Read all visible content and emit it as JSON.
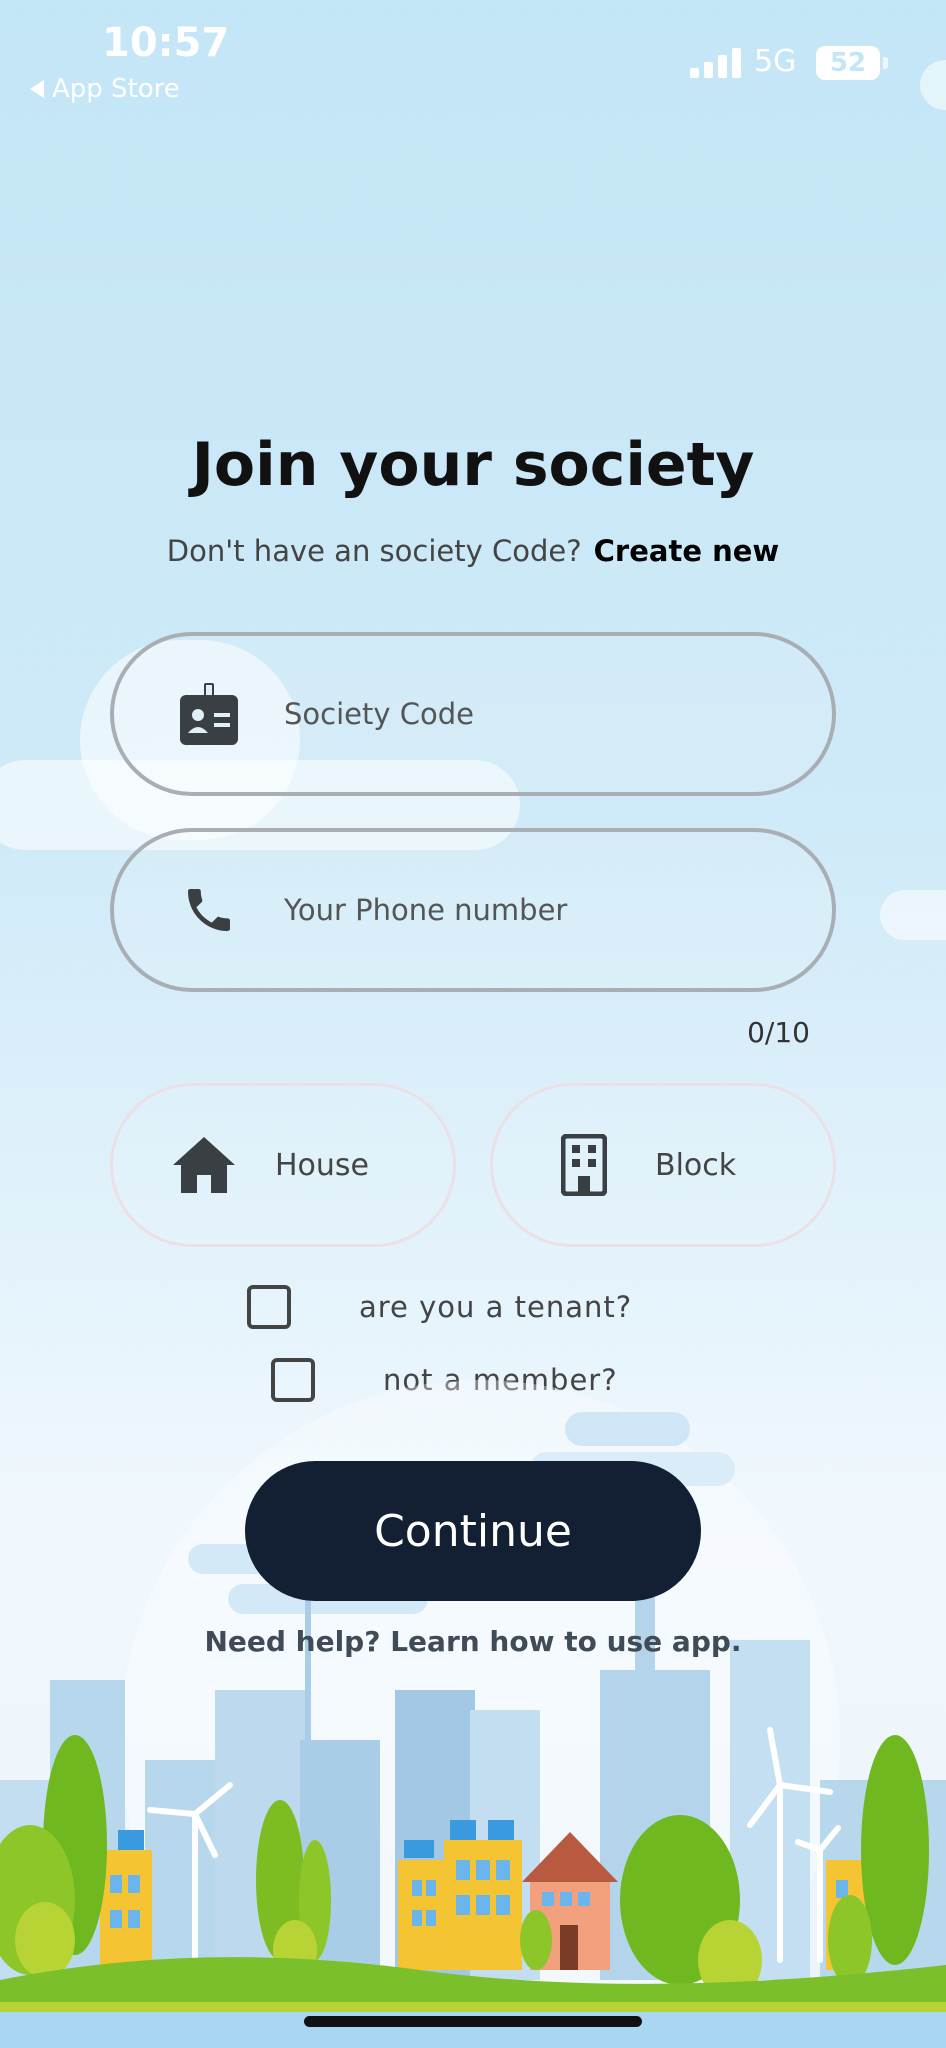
{
  "status_bar": {
    "time": "10:57",
    "back_label": "App Store",
    "network": "5G",
    "battery": "52"
  },
  "header": {
    "title": "Join your society",
    "subtitle": "Don't have an society Code?",
    "create_link": "Create new"
  },
  "form": {
    "society_code": {
      "placeholder": "Society Code",
      "icon": "id-badge-icon"
    },
    "phone": {
      "placeholder": "Your Phone number",
      "icon": "phone-icon",
      "counter": "0/10"
    },
    "house": {
      "label": "House",
      "icon": "house-icon"
    },
    "block": {
      "label": "Block",
      "icon": "building-icon"
    },
    "tenant_checkbox": {
      "label": "are you a tenant?",
      "checked": false
    },
    "member_checkbox": {
      "label": "not a member?",
      "checked": false
    }
  },
  "actions": {
    "continue_label": "Continue",
    "help_text": "Need help? Learn how to use app."
  },
  "colors": {
    "primary_button": "#132033",
    "background_sky": "#c3e6f6",
    "field_border": "#a9aeb5"
  }
}
